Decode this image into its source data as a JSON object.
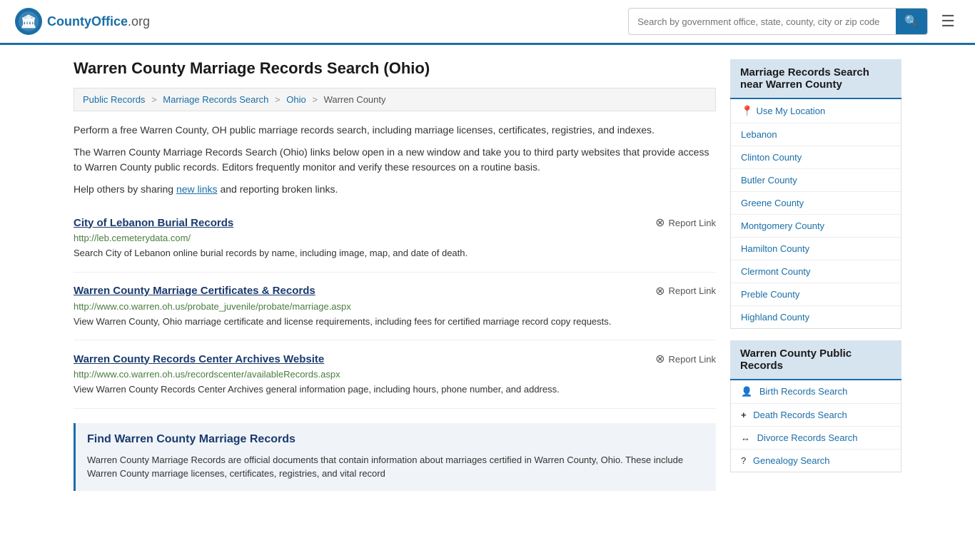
{
  "header": {
    "logo_text": "CountyOffice",
    "logo_suffix": ".org",
    "search_placeholder": "Search by government office, state, county, city or zip code",
    "search_btn_icon": "🔍"
  },
  "page": {
    "title": "Warren County Marriage Records Search (Ohio)",
    "breadcrumb": {
      "items": [
        "Public Records",
        "Marriage Records Search",
        "Ohio",
        "Warren County"
      ]
    },
    "description1": "Perform a free Warren County, OH public marriage records search, including marriage licenses, certificates, registries, and indexes.",
    "description2": "The Warren County Marriage Records Search (Ohio) links below open in a new window and take you to third party websites that provide access to Warren County public records. Editors frequently monitor and verify these resources on a routine basis.",
    "description3_prefix": "Help others by sharing ",
    "description3_link": "new links",
    "description3_suffix": " and reporting broken links.",
    "records": [
      {
        "title": "City of Lebanon Burial Records",
        "url": "http://leb.cemeterydata.com/",
        "desc": "Search City of Lebanon online burial records by name, including image, map, and date of death.",
        "report_label": "Report Link"
      },
      {
        "title": "Warren County Marriage Certificates & Records",
        "url": "http://www.co.warren.oh.us/probate_juvenile/probate/marriage.aspx",
        "desc": "View Warren County, Ohio marriage certificate and license requirements, including fees for certified marriage record copy requests.",
        "report_label": "Report Link"
      },
      {
        "title": "Warren County Records Center Archives Website",
        "url": "http://www.co.warren.oh.us/recordscenter/availableRecords.aspx",
        "desc": "View Warren County Records Center Archives general information page, including hours, phone number, and address.",
        "report_label": "Report Link"
      }
    ],
    "find_section": {
      "title": "Find Warren County Marriage Records",
      "desc": "Warren County Marriage Records are official documents that contain information about marriages certified in Warren County, Ohio. These include Warren County marriage licenses, certificates, registries, and vital record"
    }
  },
  "sidebar": {
    "nearby_section": {
      "header": "Marriage Records Search near Warren County",
      "use_location": "Use My Location",
      "items": [
        "Lebanon",
        "Clinton County",
        "Butler County",
        "Greene County",
        "Montgomery County",
        "Hamilton County",
        "Clermont County",
        "Preble County",
        "Highland County"
      ]
    },
    "public_records_section": {
      "header": "Warren County Public Records",
      "items": [
        {
          "icon": "👤",
          "label": "Birth Records Search"
        },
        {
          "icon": "+",
          "label": "Death Records Search"
        },
        {
          "icon": "↔",
          "label": "Divorce Records Search"
        },
        {
          "icon": "?",
          "label": "Genealogy Search"
        }
      ]
    }
  }
}
